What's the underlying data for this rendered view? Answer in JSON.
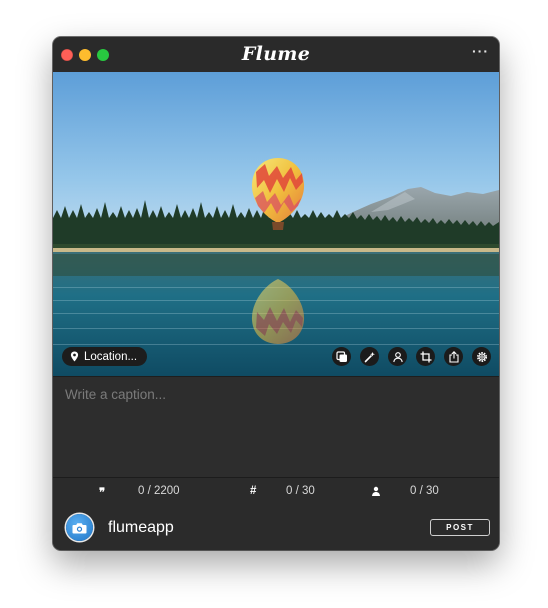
{
  "window": {
    "title": "Flume",
    "more_label": "···"
  },
  "photo": {
    "location_label": "Location...",
    "tools": [
      "multiple-images-icon",
      "filter-wand-icon",
      "tag-people-icon",
      "crop-icon",
      "share-icon",
      "settings-icon"
    ]
  },
  "caption": {
    "placeholder": "Write a caption..."
  },
  "counters": {
    "characters": "0 / 2200",
    "hashtags": "0 / 30",
    "mentions": "0 / 30"
  },
  "account": {
    "username": "flumeapp"
  },
  "post_button": {
    "label": "POST"
  },
  "colors": {
    "window_bg": "#2b2b2b",
    "close": "#fe5f57",
    "minimize": "#febc2e",
    "zoom": "#28c840",
    "avatar": "#2f8fe0"
  }
}
